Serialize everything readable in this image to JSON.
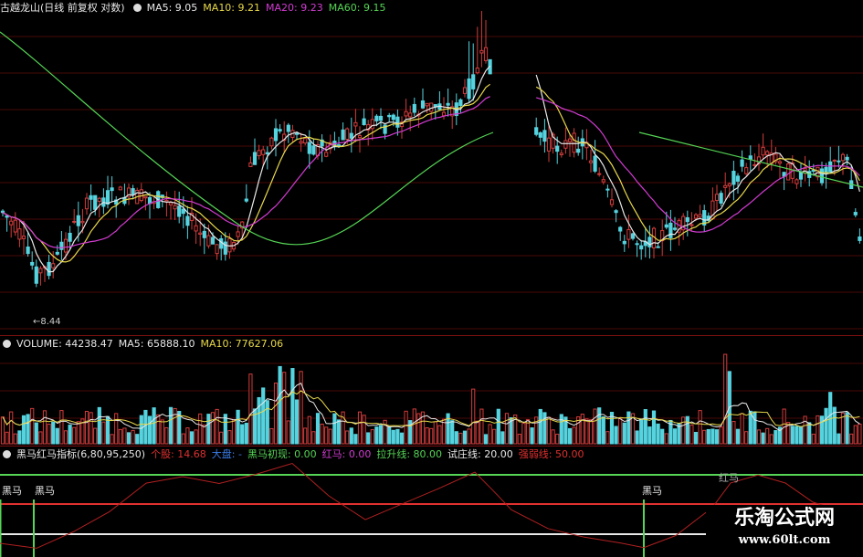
{
  "price_panel": {
    "title": "古越龙山(日线 前复权 对数)",
    "ma5": {
      "label": "MA5: 9.05",
      "color": "#e8e8e8"
    },
    "ma10": {
      "label": "MA10: 9.21",
      "color": "#e8d84a"
    },
    "ma20": {
      "label": "MA20: 9.23",
      "color": "#d23cd2"
    },
    "ma60": {
      "label": "MA60: 9.15",
      "color": "#55d455"
    },
    "low_marker": "8.44",
    "up_color": "#d23c3c",
    "down_color": "#55d4e0"
  },
  "volume_panel": {
    "volume": "VOLUME: 44238.47",
    "ma5": "MA5: 65888.10",
    "ma10": "MA10: 77627.06"
  },
  "indicator_panel": {
    "name": "黑马红马指标(6,80,95,250)",
    "items": [
      {
        "label": "个股: 14.68",
        "color": "#e03030"
      },
      {
        "label": "大盘: -",
        "color": "#3a7de8"
      },
      {
        "label": "黑马初现: 0.00",
        "color": "#55d455"
      },
      {
        "label": "红马: 0.00",
        "color": "#d23cd2"
      },
      {
        "label": "拉升线: 80.00",
        "color": "#55d455"
      },
      {
        "label": "试庄线: 20.00",
        "color": "#e8e8e8"
      },
      {
        "label": "强弱线: 50.00",
        "color": "#e03030"
      }
    ],
    "signal_label_1": "黑马",
    "signal_label_2": "黑马",
    "signal_label_3": "黑马",
    "signal_label_4": "红马"
  },
  "watermark": {
    "title": "乐淘公式网",
    "url": "www.60lt.com"
  }
}
